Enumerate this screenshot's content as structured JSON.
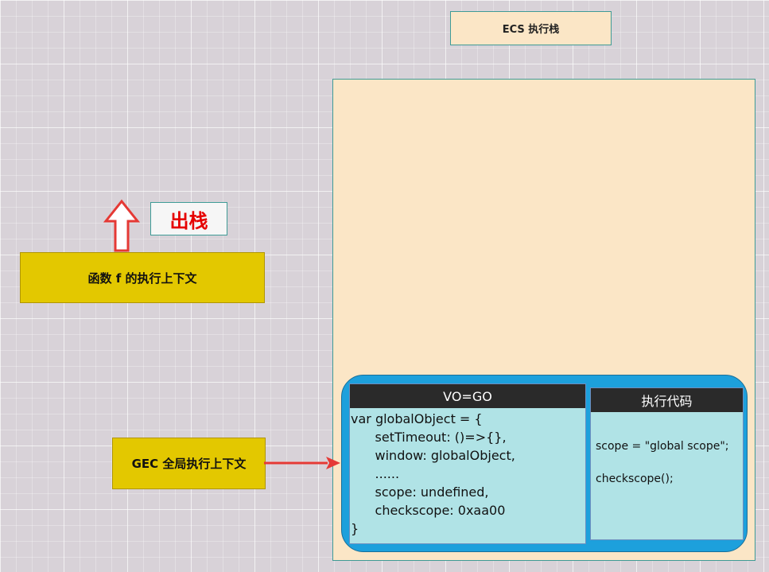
{
  "ecs": {
    "title": "ECS 执行栈"
  },
  "function_context": {
    "label": "函数 f 的执行上下文"
  },
  "pop": {
    "label": "出栈"
  },
  "gec": {
    "label": "GEC 全局执行上下文"
  },
  "vo": {
    "header": "VO=GO",
    "code": "var globalObject = {\n      setTimeout: ()=>{},\n      window: globalObject,\n      ......\n      scope: undefined,\n      checkscope: 0xaa00\n}"
  },
  "exec": {
    "header": "执行代码",
    "line1": "scope = \"global scope\";",
    "line2": "checkscope();"
  },
  "colors": {
    "stack_bg": "#fbe6c6",
    "context_bg": "#e3c800",
    "gec_frame": "#1da0dc",
    "panel_bg": "#b0e3e6",
    "header_bg": "#2a2a2a",
    "arrow_red": "#e53935"
  }
}
